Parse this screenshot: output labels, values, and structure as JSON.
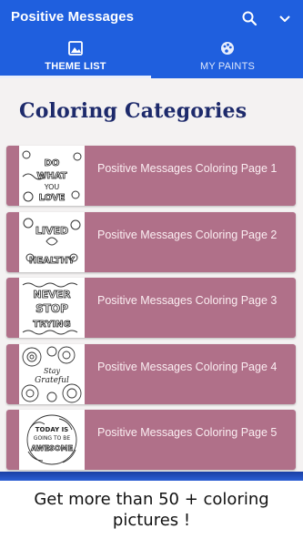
{
  "app_bar": {
    "title": "Positive Messages",
    "color": "#1f5fde",
    "icons": [
      "search-icon",
      "chevron-down-icon"
    ]
  },
  "tabs": [
    {
      "label": "THEME LIST",
      "icon": "image-icon",
      "selected": true
    },
    {
      "label": "MY PAINTS",
      "icon": "palette-icon",
      "selected": false
    }
  ],
  "main": {
    "heading": "Coloring Categories",
    "items": [
      {
        "label": "Positive Messages Coloring Page 1",
        "thumb_text": "DO WHAT YOU LOVE"
      },
      {
        "label": "Positive Messages Coloring Page 2",
        "thumb_text": "LIVED HEALTHY"
      },
      {
        "label": "Positive Messages Coloring Page 3",
        "thumb_text": "NEVER STOP TRYING"
      },
      {
        "label": "Positive Messages Coloring Page 4",
        "thumb_text": "Stay Grateful"
      },
      {
        "label": "Positive Messages Coloring Page 5",
        "thumb_text": "TODAY IS GOING TO BE AWESOME"
      }
    ],
    "card_color": "#b07089"
  },
  "promo": {
    "text": "Get more than 50 + coloring pictures !"
  }
}
